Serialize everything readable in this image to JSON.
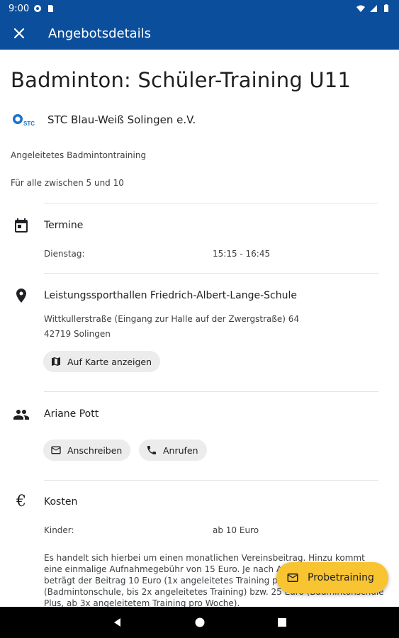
{
  "status_bar": {
    "time": "9:00"
  },
  "app_bar": {
    "title": "Angebotsdetails",
    "close_icon": "close-icon"
  },
  "offer": {
    "title": "Badminton: Schüler-Training U11",
    "club_name": "STC Blau-Weiß Solingen e.V.",
    "description": "Angeleitetes Badmintontraining",
    "age_info": "Für alle zwischen 5 und 10"
  },
  "schedule": {
    "title": "Termine",
    "day": "Dienstag:",
    "time": "15:15 - 16:45"
  },
  "location": {
    "name": "Leistungssporthallen Friedrich-Albert-Lange-Schule",
    "street": "Wittkullerstraße (Eingang zur Halle auf der Zwergstraße) 64",
    "city": "42719 Solingen",
    "map_button": "Auf Karte anzeigen"
  },
  "contact": {
    "name": "Ariane Pott",
    "write_button": "Anschreiben",
    "call_button": "Anrufen"
  },
  "costs": {
    "title": "Kosten",
    "label": "Kinder:",
    "value": "ab 10 Euro",
    "details": "Es handelt sich hierbei um einen monatlichen Vereinsbeitrag. Hinzu kommt eine einmalige Aufnahmegebühr von 15 Euro. Je nach Anzahl pro Woche beträgt der Beitrag 10 Euro (1x angeleitetes Training pro Woche), 15 Euro (Badmintonschule, bis 2x angeleitetes Training) bzw. 25 Euro (Badmintonschule Plus, ab 3x angeleitetem Training pro Woche)."
  },
  "fab": {
    "label": "Probetraining"
  },
  "colors": {
    "primary": "#0b4e9b",
    "accent": "#f9c431"
  }
}
